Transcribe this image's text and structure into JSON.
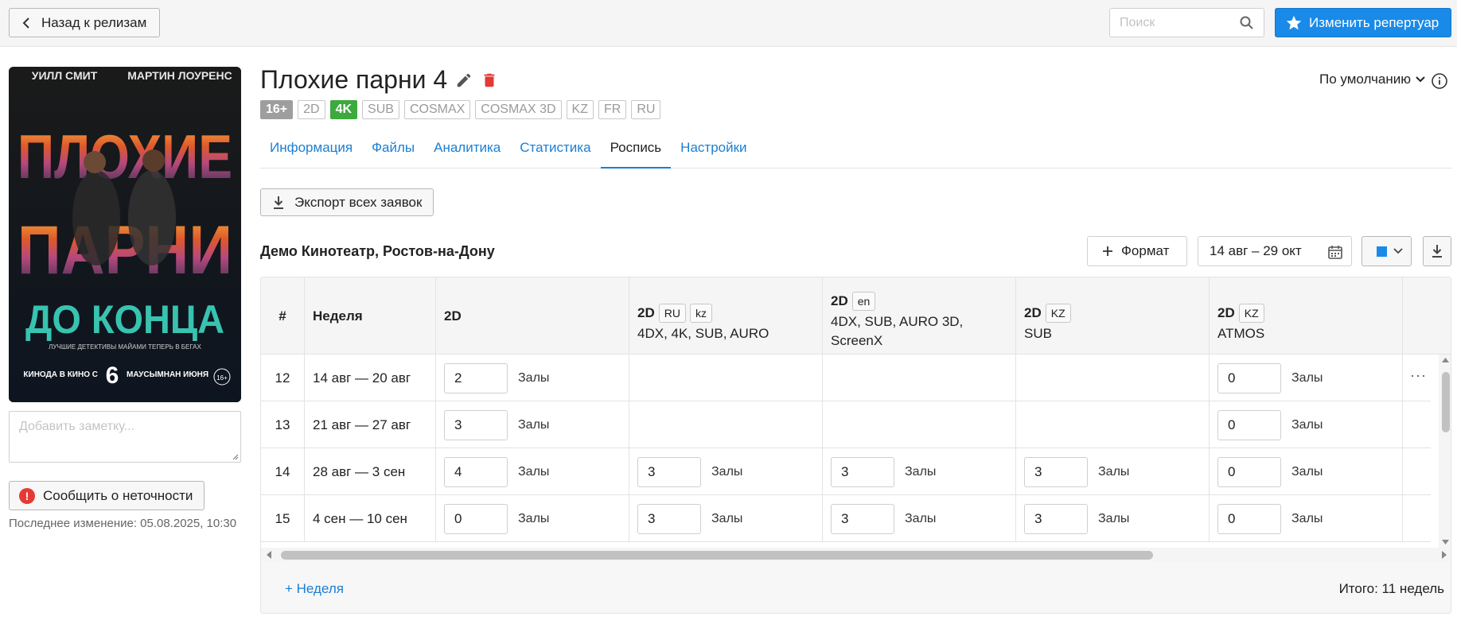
{
  "topbar": {
    "back_label": "Назад к релизам",
    "search_placeholder": "Поиск",
    "edit_repertoire_label": "Изменить репертуар"
  },
  "release": {
    "title": "Плохие парни 4",
    "badges": [
      "16+",
      "2D",
      "4K",
      "SUB",
      "COSMAX",
      "COSMAX 3D",
      "KZ",
      "FR",
      "RU"
    ],
    "note_placeholder": "Добавить заметку...",
    "report_label": "Сообщить о неточности",
    "last_change": "Последнее изменение: 05.08.2025, 10:30",
    "poster": {
      "top_names": [
        "УИЛЛ СМИТ",
        "МАРТИН ЛОУРЕНС"
      ],
      "title_lines": [
        "ПЛОХИЕ",
        "ПАРНИ"
      ],
      "subtitle": "ДО КОНЦА",
      "tagline": "ЛУЧШИЕ ДЕТЕКТИВЫ МАЙАМИ ТЕПЕРЬ В БЕГАХ",
      "date_left": "КИНОДА В КИНО С",
      "date_day": "6",
      "date_right": "МАУСЫМНАН ИЮНЯ",
      "rating": "16+"
    }
  },
  "header": {
    "sort_label": "По умолчанию"
  },
  "tabs": [
    {
      "label": "Информация",
      "active": false
    },
    {
      "label": "Файлы",
      "active": false
    },
    {
      "label": "Аналитика",
      "active": false
    },
    {
      "label": "Статистика",
      "active": false
    },
    {
      "label": "Роспись",
      "active": true
    },
    {
      "label": "Настройки",
      "active": false
    }
  ],
  "schedule": {
    "export_label": "Экспорт всех заявок",
    "cinema": "Демо Кинотеатр, Ростов-на-Дону",
    "format_label": "Формат",
    "date_range": "14 авг – 29 окт",
    "color_accent": "#1a8ae8",
    "columns": {
      "num": "#",
      "week": "Неделя",
      "formats": [
        {
          "title": "2D",
          "langs": [],
          "sub": ""
        },
        {
          "title": "2D",
          "langs": [
            "RU",
            "kz"
          ],
          "sub": "4DX, 4K, SUB, AURO"
        },
        {
          "title": "2D",
          "langs": [
            "en"
          ],
          "sub": "4DX, SUB, AURO 3D, ScreenX"
        },
        {
          "title": "2D",
          "langs": [
            "KZ"
          ],
          "sub": "SUB"
        },
        {
          "title": "2D",
          "langs": [
            "KZ"
          ],
          "sub": "ATMOS"
        }
      ]
    },
    "halls_label": "Залы",
    "more_label": "···",
    "rows": [
      {
        "num": "12",
        "week": "14 авг — 20 авг",
        "values": [
          "2",
          null,
          null,
          null,
          "0"
        ]
      },
      {
        "num": "13",
        "week": "21 авг — 27 авг",
        "values": [
          "3",
          null,
          null,
          null,
          "0"
        ]
      },
      {
        "num": "14",
        "week": "28 авг — 3 сен",
        "values": [
          "4",
          "3",
          "3",
          "3",
          "0"
        ]
      },
      {
        "num": "15",
        "week": "4 сен — 10 сен",
        "values": [
          "0",
          "3",
          "3",
          "3",
          "0"
        ]
      }
    ],
    "add_week_label": "+ Неделя",
    "total_label": "Итого: 11 недель"
  }
}
